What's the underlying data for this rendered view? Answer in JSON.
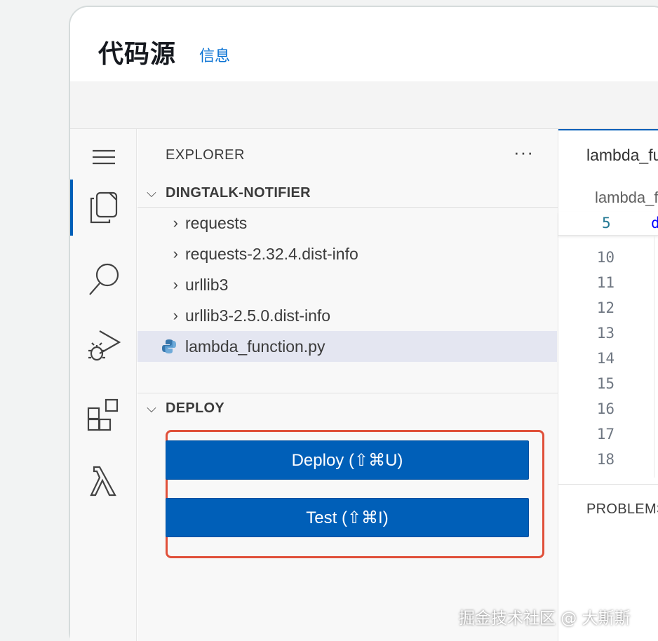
{
  "header": {
    "title": "代码源",
    "info_link": "信息"
  },
  "activity_bar": {
    "items": [
      {
        "icon": "menu-icon"
      },
      {
        "icon": "files-icon",
        "active": true
      },
      {
        "icon": "search-icon"
      },
      {
        "icon": "run-debug-icon"
      },
      {
        "icon": "extensions-icon"
      },
      {
        "icon": "lambda-icon"
      }
    ]
  },
  "explorer": {
    "title": "EXPLORER",
    "more": "···",
    "root_folder": "DINGTALK-NOTIFIER",
    "items": [
      {
        "label": "requests",
        "type": "folder"
      },
      {
        "label": "requests-2.32.4.dist-info",
        "type": "folder"
      },
      {
        "label": "urllib3",
        "type": "folder"
      },
      {
        "label": "urllib3-2.5.0.dist-info",
        "type": "folder"
      },
      {
        "label": "lambda_function.py",
        "type": "file",
        "selected": true
      }
    ]
  },
  "deploy": {
    "title": "DEPLOY",
    "deploy_button": "Deploy (⇧⌘U)",
    "test_button": "Test (⇧⌘I)"
  },
  "editor": {
    "tab_label": "lambda_function.py",
    "breadcrumb": "lambda_function.py",
    "sticky_line_number": "5",
    "sticky_code": "def lambda_handler(event, context):",
    "line_numbers": [
      "10",
      "11",
      "12",
      "13",
      "14",
      "15",
      "16",
      "17",
      "18"
    ]
  },
  "panel": {
    "tab": "PROBLEMS"
  },
  "watermark": "掘金技术社区 @ 大斯斯",
  "colors": {
    "accent": "#005fb8",
    "highlight_frame": "#e0503a",
    "link": "#0972d3"
  }
}
